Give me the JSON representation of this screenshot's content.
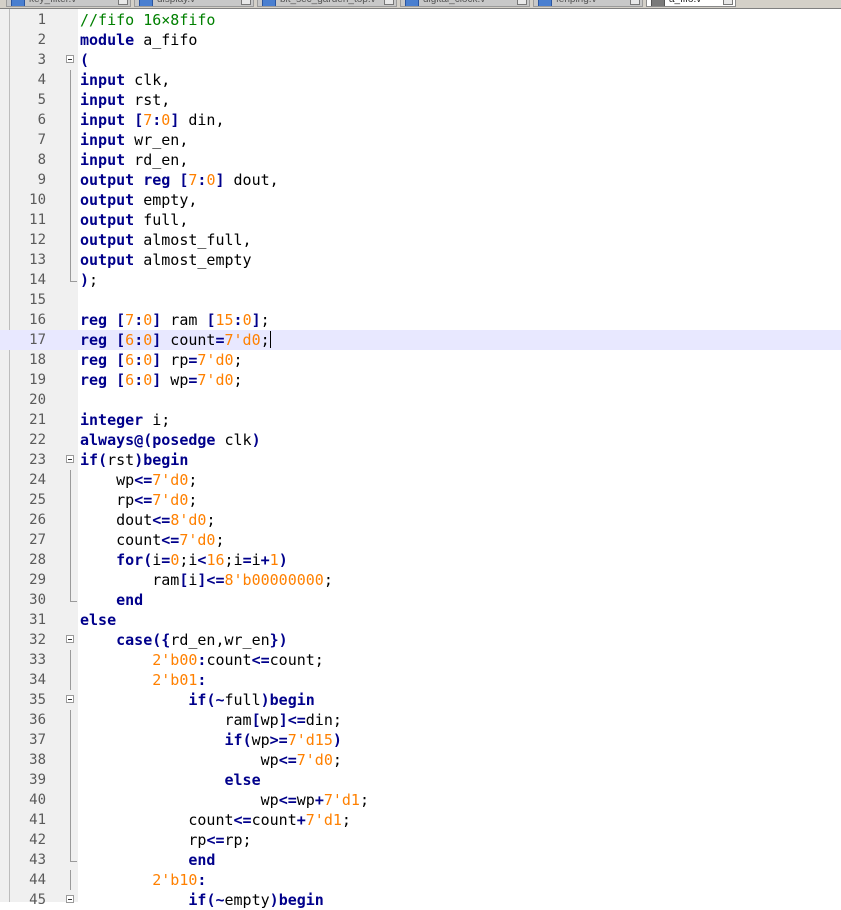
{
  "tabs": [
    {
      "label": "key_filter.v",
      "active": false
    },
    {
      "label": "display.v",
      "active": false
    },
    {
      "label": "bit_sec_garden_top.v",
      "active": false
    },
    {
      "label": "digital_clock.v",
      "active": false
    },
    {
      "label": "fenping.v",
      "active": false
    },
    {
      "label": "a_fifo.v",
      "active": true
    }
  ],
  "colors": {
    "keyword": "#00008b",
    "number": "#ff8000",
    "comment": "#008000",
    "gutter": "#f0f0f0",
    "current_line": "#e8e8ff"
  },
  "editor": {
    "current_line": 17,
    "lines": [
      {
        "n": "1",
        "fold": "",
        "tokens": [
          [
            "com",
            "//fifo 16×8fifo"
          ]
        ]
      },
      {
        "n": "2",
        "fold": "",
        "tokens": [
          [
            "kw",
            "module"
          ],
          [
            "id",
            " a_fifo"
          ]
        ]
      },
      {
        "n": "3",
        "fold": "open",
        "tokens": [
          [
            "op",
            "("
          ]
        ]
      },
      {
        "n": "4",
        "fold": "line",
        "tokens": [
          [
            "kw",
            "input"
          ],
          [
            "id",
            " clk,"
          ]
        ]
      },
      {
        "n": "5",
        "fold": "line",
        "tokens": [
          [
            "kw",
            "input"
          ],
          [
            "id",
            " rst,"
          ]
        ]
      },
      {
        "n": "6",
        "fold": "line",
        "tokens": [
          [
            "kw",
            "input"
          ],
          [
            "id",
            " "
          ],
          [
            "op",
            "["
          ],
          [
            "num",
            "7"
          ],
          [
            "op",
            ":"
          ],
          [
            "num",
            "0"
          ],
          [
            "op",
            "]"
          ],
          [
            "id",
            " din,"
          ]
        ]
      },
      {
        "n": "7",
        "fold": "line",
        "tokens": [
          [
            "kw",
            "input"
          ],
          [
            "id",
            " wr_en,"
          ]
        ]
      },
      {
        "n": "8",
        "fold": "line",
        "tokens": [
          [
            "kw",
            "input"
          ],
          [
            "id",
            " rd_en,"
          ]
        ]
      },
      {
        "n": "9",
        "fold": "line",
        "tokens": [
          [
            "kw",
            "output"
          ],
          [
            "id",
            " "
          ],
          [
            "kw",
            "reg"
          ],
          [
            "id",
            " "
          ],
          [
            "op",
            "["
          ],
          [
            "num",
            "7"
          ],
          [
            "op",
            ":"
          ],
          [
            "num",
            "0"
          ],
          [
            "op",
            "]"
          ],
          [
            "id",
            " dout,"
          ]
        ]
      },
      {
        "n": "10",
        "fold": "line",
        "tokens": [
          [
            "kw",
            "output"
          ],
          [
            "id",
            " empty,"
          ]
        ]
      },
      {
        "n": "11",
        "fold": "line",
        "tokens": [
          [
            "kw",
            "output"
          ],
          [
            "id",
            " full,"
          ]
        ]
      },
      {
        "n": "12",
        "fold": "line",
        "tokens": [
          [
            "kw",
            "output"
          ],
          [
            "id",
            " almost_full,"
          ]
        ]
      },
      {
        "n": "13",
        "fold": "line",
        "tokens": [
          [
            "kw",
            "output"
          ],
          [
            "id",
            " almost_empty"
          ]
        ]
      },
      {
        "n": "14",
        "fold": "end",
        "tokens": [
          [
            "op",
            ")"
          ],
          [
            "id",
            ";"
          ]
        ]
      },
      {
        "n": "15",
        "fold": "",
        "tokens": []
      },
      {
        "n": "16",
        "fold": "",
        "tokens": [
          [
            "kw",
            "reg"
          ],
          [
            "id",
            " "
          ],
          [
            "op",
            "["
          ],
          [
            "num",
            "7"
          ],
          [
            "op",
            ":"
          ],
          [
            "num",
            "0"
          ],
          [
            "op",
            "]"
          ],
          [
            "id",
            " ram "
          ],
          [
            "op",
            "["
          ],
          [
            "num",
            "15"
          ],
          [
            "op",
            ":"
          ],
          [
            "num",
            "0"
          ],
          [
            "op",
            "]"
          ],
          [
            "id",
            ";"
          ]
        ]
      },
      {
        "n": "17",
        "fold": "",
        "tokens": [
          [
            "kw",
            "reg"
          ],
          [
            "id",
            " "
          ],
          [
            "op",
            "["
          ],
          [
            "num",
            "6"
          ],
          [
            "op",
            ":"
          ],
          [
            "num",
            "0"
          ],
          [
            "op",
            "]"
          ],
          [
            "id",
            " count"
          ],
          [
            "op",
            "="
          ],
          [
            "num",
            "7'd0"
          ],
          [
            "id",
            ";"
          ]
        ],
        "caret": true
      },
      {
        "n": "18",
        "fold": "",
        "tokens": [
          [
            "kw",
            "reg"
          ],
          [
            "id",
            " "
          ],
          [
            "op",
            "["
          ],
          [
            "num",
            "6"
          ],
          [
            "op",
            ":"
          ],
          [
            "num",
            "0"
          ],
          [
            "op",
            "]"
          ],
          [
            "id",
            " rp"
          ],
          [
            "op",
            "="
          ],
          [
            "num",
            "7'd0"
          ],
          [
            "id",
            ";"
          ]
        ]
      },
      {
        "n": "19",
        "fold": "",
        "tokens": [
          [
            "kw",
            "reg"
          ],
          [
            "id",
            " "
          ],
          [
            "op",
            "["
          ],
          [
            "num",
            "6"
          ],
          [
            "op",
            ":"
          ],
          [
            "num",
            "0"
          ],
          [
            "op",
            "]"
          ],
          [
            "id",
            " wp"
          ],
          [
            "op",
            "="
          ],
          [
            "num",
            "7'd0"
          ],
          [
            "id",
            ";"
          ]
        ]
      },
      {
        "n": "20",
        "fold": "",
        "tokens": []
      },
      {
        "n": "21",
        "fold": "",
        "tokens": [
          [
            "kw",
            "integer"
          ],
          [
            "id",
            " i;"
          ]
        ]
      },
      {
        "n": "22",
        "fold": "",
        "tokens": [
          [
            "kw",
            "always"
          ],
          [
            "op",
            "@("
          ],
          [
            "kw",
            "posedge"
          ],
          [
            "id",
            " clk"
          ],
          [
            "op",
            ")"
          ]
        ]
      },
      {
        "n": "23",
        "fold": "open",
        "tokens": [
          [
            "kw",
            "if"
          ],
          [
            "op",
            "("
          ],
          [
            "id",
            "rst"
          ],
          [
            "op",
            ")"
          ],
          [
            "kw",
            "begin"
          ]
        ]
      },
      {
        "n": "24",
        "fold": "line",
        "tokens": [
          [
            "id",
            "    wp"
          ],
          [
            "op",
            "<="
          ],
          [
            "num",
            "7'd0"
          ],
          [
            "id",
            ";"
          ]
        ]
      },
      {
        "n": "25",
        "fold": "line",
        "tokens": [
          [
            "id",
            "    rp"
          ],
          [
            "op",
            "<="
          ],
          [
            "num",
            "7'd0"
          ],
          [
            "id",
            ";"
          ]
        ]
      },
      {
        "n": "26",
        "fold": "line",
        "tokens": [
          [
            "id",
            "    dout"
          ],
          [
            "op",
            "<="
          ],
          [
            "num",
            "8'd0"
          ],
          [
            "id",
            ";"
          ]
        ]
      },
      {
        "n": "27",
        "fold": "line",
        "tokens": [
          [
            "id",
            "    count"
          ],
          [
            "op",
            "<="
          ],
          [
            "num",
            "7'd0"
          ],
          [
            "id",
            ";"
          ]
        ]
      },
      {
        "n": "28",
        "fold": "line",
        "tokens": [
          [
            "id",
            "    "
          ],
          [
            "kw",
            "for"
          ],
          [
            "op",
            "("
          ],
          [
            "id",
            "i"
          ],
          [
            "op",
            "="
          ],
          [
            "num",
            "0"
          ],
          [
            "id",
            ";i"
          ],
          [
            "op",
            "<"
          ],
          [
            "num",
            "16"
          ],
          [
            "id",
            ";i"
          ],
          [
            "op",
            "="
          ],
          [
            "id",
            "i"
          ],
          [
            "op",
            "+"
          ],
          [
            "num",
            "1"
          ],
          [
            "op",
            ")"
          ]
        ]
      },
      {
        "n": "29",
        "fold": "line",
        "tokens": [
          [
            "id",
            "        ram"
          ],
          [
            "op",
            "["
          ],
          [
            "id",
            "i"
          ],
          [
            "op",
            "]<="
          ],
          [
            "num",
            "8'b00000000"
          ],
          [
            "id",
            ";"
          ]
        ]
      },
      {
        "n": "30",
        "fold": "end",
        "tokens": [
          [
            "id",
            "    "
          ],
          [
            "kw",
            "end"
          ]
        ]
      },
      {
        "n": "31",
        "fold": "",
        "tokens": [
          [
            "kw",
            "else"
          ]
        ]
      },
      {
        "n": "32",
        "fold": "open",
        "tokens": [
          [
            "id",
            "    "
          ],
          [
            "kw",
            "case"
          ],
          [
            "op",
            "({"
          ],
          [
            "id",
            "rd_en,wr_en"
          ],
          [
            "op",
            "})"
          ]
        ]
      },
      {
        "n": "33",
        "fold": "line",
        "tokens": [
          [
            "id",
            "        "
          ],
          [
            "num",
            "2'b00"
          ],
          [
            "op",
            ":"
          ],
          [
            "id",
            "count"
          ],
          [
            "op",
            "<="
          ],
          [
            "id",
            "count;"
          ]
        ]
      },
      {
        "n": "34",
        "fold": "line",
        "tokens": [
          [
            "id",
            "        "
          ],
          [
            "num",
            "2'b01"
          ],
          [
            "op",
            ":"
          ]
        ]
      },
      {
        "n": "35",
        "fold": "open",
        "tokens": [
          [
            "id",
            "            "
          ],
          [
            "kw",
            "if"
          ],
          [
            "op",
            "(~"
          ],
          [
            "id",
            "full"
          ],
          [
            "op",
            ")"
          ],
          [
            "kw",
            "begin"
          ]
        ]
      },
      {
        "n": "36",
        "fold": "line",
        "tokens": [
          [
            "id",
            "                ram"
          ],
          [
            "op",
            "["
          ],
          [
            "id",
            "wp"
          ],
          [
            "op",
            "]<="
          ],
          [
            "id",
            "din;"
          ]
        ]
      },
      {
        "n": "37",
        "fold": "line",
        "tokens": [
          [
            "id",
            "                "
          ],
          [
            "kw",
            "if"
          ],
          [
            "op",
            "("
          ],
          [
            "id",
            "wp"
          ],
          [
            "op",
            ">="
          ],
          [
            "num",
            "7'd15"
          ],
          [
            "op",
            ")"
          ]
        ]
      },
      {
        "n": "38",
        "fold": "line",
        "tokens": [
          [
            "id",
            "                    wp"
          ],
          [
            "op",
            "<="
          ],
          [
            "num",
            "7'd0"
          ],
          [
            "id",
            ";"
          ]
        ]
      },
      {
        "n": "39",
        "fold": "line",
        "tokens": [
          [
            "id",
            "                "
          ],
          [
            "kw",
            "else"
          ]
        ]
      },
      {
        "n": "40",
        "fold": "line",
        "tokens": [
          [
            "id",
            "                    wp"
          ],
          [
            "op",
            "<="
          ],
          [
            "id",
            "wp"
          ],
          [
            "op",
            "+"
          ],
          [
            "num",
            "7'd1"
          ],
          [
            "id",
            ";"
          ]
        ]
      },
      {
        "n": "41",
        "fold": "line",
        "tokens": [
          [
            "id",
            "            count"
          ],
          [
            "op",
            "<="
          ],
          [
            "id",
            "count"
          ],
          [
            "op",
            "+"
          ],
          [
            "num",
            "7'd1"
          ],
          [
            "id",
            ";"
          ]
        ]
      },
      {
        "n": "42",
        "fold": "line",
        "tokens": [
          [
            "id",
            "            rp"
          ],
          [
            "op",
            "<="
          ],
          [
            "id",
            "rp;"
          ]
        ]
      },
      {
        "n": "43",
        "fold": "end",
        "tokens": [
          [
            "id",
            "            "
          ],
          [
            "kw",
            "end"
          ]
        ]
      },
      {
        "n": "44",
        "fold": "line",
        "tokens": [
          [
            "id",
            "        "
          ],
          [
            "num",
            "2'b10"
          ],
          [
            "op",
            ":"
          ]
        ]
      },
      {
        "n": "45",
        "fold": "open",
        "tokens": [
          [
            "id",
            "            "
          ],
          [
            "kw",
            "if"
          ],
          [
            "op",
            "(~"
          ],
          [
            "id",
            "empty"
          ],
          [
            "op",
            ")"
          ],
          [
            "kw",
            "begin"
          ]
        ]
      }
    ]
  }
}
